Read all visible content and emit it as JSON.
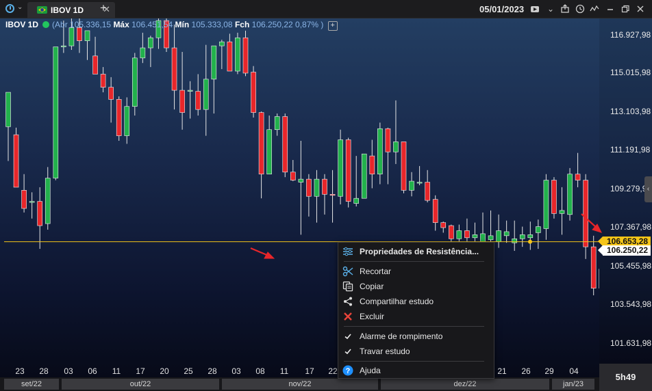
{
  "topbar": {
    "tab_label": "IBOV 1D",
    "tab_close": "✕",
    "add_tab": "+",
    "date": "05/01/2023"
  },
  "info": {
    "symbol": "IBOV 1D",
    "abr_label": "(Abr",
    "abr_value": "105.336,15",
    "max_label": "Máx",
    "max_value": "106.451,54",
    "min_label": "Mín",
    "min_value": "105.333,08",
    "fch_label": "Fch",
    "fch_value": "106.250,22",
    "change": "0,87% )",
    "plus": "+"
  },
  "y_axis": [
    "116.927,98",
    "115.015,98",
    "113.103,98",
    "111.191,98",
    "109.279,98",
    "107.367,98",
    "105.455,98",
    "103.543,98",
    "101.631,98"
  ],
  "price_tags": {
    "line": "106.653,28",
    "last": "106.250,22"
  },
  "x_axis": [
    "23",
    "28",
    "03",
    "06",
    "11",
    "17",
    "20",
    "25",
    "28",
    "03",
    "08",
    "11",
    "17",
    "22",
    "21",
    "26",
    "29",
    "04"
  ],
  "months": [
    "set/22",
    "out/22",
    "nov/22",
    "dez/22",
    "jan/23"
  ],
  "time_left": "5h49",
  "context_menu": {
    "title": "Propriedades de Resistência...",
    "items": [
      "Recortar",
      "Copiar",
      "Compartilhar estudo",
      "Excluir"
    ],
    "checks": [
      "Alarme de rompimento",
      "Travar estudo"
    ],
    "help": "Ajuda"
  },
  "colors": {
    "up": "#22b14c",
    "down": "#e8262a",
    "line": "#f5c518",
    "accent": "#5ab0e8"
  },
  "chart_data": {
    "type": "candlestick",
    "symbol": "IBOV",
    "interval": "1D",
    "resistance_line": 106653.28,
    "last": 106250.22,
    "candles": [
      {
        "o": 112350,
        "h": 113650,
        "l": 110650,
        "c": 114050
      },
      {
        "o": 111950,
        "h": 112300,
        "l": 109350,
        "c": 109350
      },
      {
        "o": 109200,
        "h": 110000,
        "l": 108100,
        "c": 108300
      },
      {
        "o": 108600,
        "h": 109100,
        "l": 107800,
        "c": 108650
      },
      {
        "o": 108650,
        "h": 109350,
        "l": 106300,
        "c": 107450
      },
      {
        "o": 107550,
        "h": 110350,
        "l": 107250,
        "c": 109800
      },
      {
        "o": 109800,
        "h": 116150,
        "l": 109700,
        "c": 116300
      },
      {
        "o": 116300,
        "h": 117600,
        "l": 116000,
        "c": 116350
      },
      {
        "o": 116350,
        "h": 117900,
        "l": 116150,
        "c": 117250
      },
      {
        "o": 117250,
        "h": 117800,
        "l": 116000,
        "c": 116600
      },
      {
        "o": 116600,
        "h": 117000,
        "l": 115650,
        "c": 117100
      },
      {
        "o": 115850,
        "h": 116800,
        "l": 115350,
        "c": 114950
      },
      {
        "o": 114950,
        "h": 115300,
        "l": 114050,
        "c": 114300
      },
      {
        "o": 114300,
        "h": 114800,
        "l": 112550,
        "c": 113700
      },
      {
        "o": 113700,
        "h": 113850,
        "l": 111650,
        "c": 111900
      },
      {
        "o": 111900,
        "h": 113800,
        "l": 111500,
        "c": 113350
      },
      {
        "o": 113350,
        "h": 116000,
        "l": 112900,
        "c": 115750
      },
      {
        "o": 115750,
        "h": 117000,
        "l": 115500,
        "c": 116250
      },
      {
        "o": 116250,
        "h": 116850,
        "l": 115300,
        "c": 116750
      },
      {
        "o": 116750,
        "h": 117800,
        "l": 116200,
        "c": 117600
      },
      {
        "o": 117600,
        "h": 117850,
        "l": 116050,
        "c": 116250
      },
      {
        "o": 116250,
        "h": 117400,
        "l": 113200,
        "c": 114150
      },
      {
        "o": 114150,
        "h": 116050,
        "l": 112200,
        "c": 113050
      },
      {
        "o": 114100,
        "h": 114600,
        "l": 112750,
        "c": 114150
      },
      {
        "o": 114100,
        "h": 114950,
        "l": 112900,
        "c": 113200
      },
      {
        "o": 113200,
        "h": 116400,
        "l": 111900,
        "c": 114700
      },
      {
        "o": 114700,
        "h": 116000,
        "l": 113000,
        "c": 116350
      },
      {
        "o": 116350,
        "h": 116650,
        "l": 115200,
        "c": 116550
      },
      {
        "o": 116550,
        "h": 116950,
        "l": 115700,
        "c": 115100
      },
      {
        "o": 115100,
        "h": 117000,
        "l": 114950,
        "c": 116750
      },
      {
        "o": 116750,
        "h": 117100,
        "l": 114850,
        "c": 115000
      },
      {
        "o": 115050,
        "h": 115350,
        "l": 112800,
        "c": 113050
      },
      {
        "o": 113050,
        "h": 113100,
        "l": 108800,
        "c": 110000
      },
      {
        "o": 110000,
        "h": 112900,
        "l": 110050,
        "c": 112200
      },
      {
        "o": 112200,
        "h": 113000,
        "l": 111900,
        "c": 112850
      },
      {
        "o": 112850,
        "h": 113000,
        "l": 109850,
        "c": 110100
      },
      {
        "o": 110100,
        "h": 110700,
        "l": 109650,
        "c": 109700
      },
      {
        "o": 109600,
        "h": 111650,
        "l": 107000,
        "c": 109750
      },
      {
        "o": 109750,
        "h": 110000,
        "l": 107900,
        "c": 108900
      },
      {
        "o": 108900,
        "h": 110200,
        "l": 107600,
        "c": 109750
      },
      {
        "o": 109750,
        "h": 110000,
        "l": 108000,
        "c": 109000
      },
      {
        "o": 109000,
        "h": 110200,
        "l": 107600,
        "c": 108950
      },
      {
        "o": 108900,
        "h": 112200,
        "l": 108500,
        "c": 111700
      },
      {
        "o": 111700,
        "h": 111800,
        "l": 108350,
        "c": 108650
      },
      {
        "o": 108550,
        "h": 110900,
        "l": 108400,
        "c": 108800
      },
      {
        "o": 108800,
        "h": 110450,
        "l": 108800,
        "c": 111000
      },
      {
        "o": 110900,
        "h": 111700,
        "l": 109300,
        "c": 110000
      },
      {
        "o": 110000,
        "h": 112550,
        "l": 109500,
        "c": 112250
      },
      {
        "o": 112250,
        "h": 112300,
        "l": 109500,
        "c": 111100
      },
      {
        "o": 111100,
        "h": 113650,
        "l": 110500,
        "c": 111600
      },
      {
        "o": 111600,
        "h": 111600,
        "l": 109050,
        "c": 109200
      },
      {
        "o": 109200,
        "h": 110100,
        "l": 108900,
        "c": 109650
      },
      {
        "o": 109600,
        "h": 110400,
        "l": 109450,
        "c": 109600
      },
      {
        "o": 109600,
        "h": 110200,
        "l": 108600,
        "c": 108700
      },
      {
        "o": 108750,
        "h": 108950,
        "l": 107200,
        "c": 107600
      },
      {
        "o": 107600,
        "h": 107650,
        "l": 107100,
        "c": 107350
      },
      {
        "o": 107450,
        "h": 107500,
        "l": 106450,
        "c": 106800
      },
      {
        "o": 106800,
        "h": 107500,
        "l": 106500,
        "c": 107200
      },
      {
        "o": 107200,
        "h": 107800,
        "l": 106550,
        "c": 106850
      },
      {
        "o": 106850,
        "h": 107600,
        "l": 106500,
        "c": 107000
      },
      {
        "o": 106600,
        "h": 108100,
        "l": 106200,
        "c": 107050
      },
      {
        "o": 106750,
        "h": 108200,
        "l": 106350,
        "c": 106950
      },
      {
        "o": 106650,
        "h": 108000,
        "l": 106350,
        "c": 107200
      },
      {
        "o": 106950,
        "h": 107700,
        "l": 106600,
        "c": 107150
      },
      {
        "o": 106600,
        "h": 107700,
        "l": 106200,
        "c": 106800
      },
      {
        "o": 106800,
        "h": 107400,
        "l": 106400,
        "c": 107000
      },
      {
        "o": 106850,
        "h": 107650,
        "l": 106250,
        "c": 107000
      },
      {
        "o": 107100,
        "h": 107750,
        "l": 106300,
        "c": 107400
      },
      {
        "o": 107300,
        "h": 110000,
        "l": 106750,
        "c": 109700
      },
      {
        "o": 109700,
        "h": 109850,
        "l": 107800,
        "c": 108050
      },
      {
        "o": 108050,
        "h": 109350,
        "l": 107000,
        "c": 108200
      },
      {
        "o": 108000,
        "h": 110300,
        "l": 107700,
        "c": 110000
      },
      {
        "o": 110000,
        "h": 111050,
        "l": 109350,
        "c": 109700
      },
      {
        "o": 109700,
        "h": 110000,
        "l": 105800,
        "c": 106400
      },
      {
        "o": 106400,
        "h": 106950,
        "l": 104000,
        "c": 104350
      },
      {
        "o": 104350,
        "h": 105650,
        "l": 104050,
        "c": 105300
      },
      {
        "o": 105336,
        "h": 106451,
        "l": 105333,
        "c": 106250
      }
    ]
  }
}
